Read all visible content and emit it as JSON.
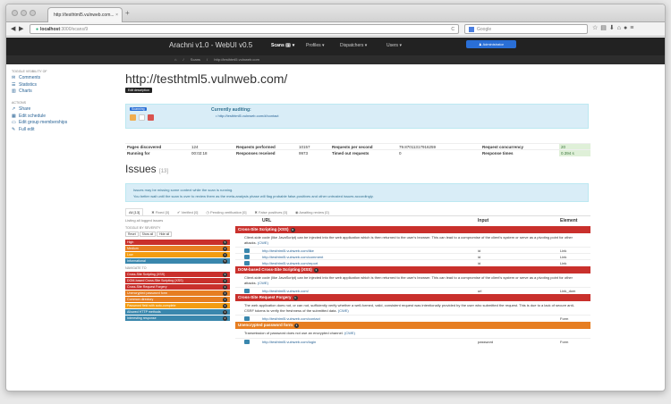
{
  "browser": {
    "tab_title": "http://testhtml5.vulnweb.com...",
    "tab_close": "×",
    "new_tab": "+",
    "url_host": "localhost",
    "url_rest": ":3000/scans/9",
    "search_placeholder": "Google",
    "reload": "C"
  },
  "nav": {
    "brand": "Arachni v1.0 - WebUI v0.5",
    "scans": "Scans",
    "scans_count": "1",
    "profiles": "Profiles ▾",
    "dispatchers": "Dispatchers ▾",
    "users": "Users ▾",
    "admin": "♟ Administrator"
  },
  "breadcrumb": {
    "home": "⌂",
    "sep1": "/",
    "scans": "Scans",
    "sep2": "/",
    "current": "http://testhtml5.vulnweb.com"
  },
  "sidebar": {
    "visibility_header": "TOGGLE VISIBILITY OF",
    "visibility_items": [
      "Comments",
      "Statistics",
      "Charts"
    ],
    "actions_header": "ACTIONS",
    "action_items": [
      "Share",
      "Edit schedule",
      "Edit group memberships",
      "Full edit"
    ]
  },
  "main": {
    "title": "http://testhtml5.vulnweb.com/",
    "edit_description": "Edit description",
    "scanning_label": "Scanning",
    "auditing_title": "Currently auditing:",
    "auditing_url": "• http://testhtml5.vulnweb.com/#/contact"
  },
  "stats": [
    [
      "Pages discovered",
      "124",
      "Requests performed",
      "10157",
      "Requests per second",
      "79.87011317916259",
      "Request concurrency",
      "20"
    ],
    [
      "Running for",
      "00:02:18",
      "Responses received",
      "9973",
      "Timed out requests",
      "0",
      "Response times",
      "0.394 s"
    ]
  ],
  "issues": {
    "title": "Issues",
    "count": "[13]",
    "warning_line1": "Issues may be missing some context while the scan is running.",
    "warning_line2": "You better wait until the scan is over to review them as the meta-analysis phase will flag probable false-positives and other untrusted issues accordingly.",
    "filters": [
      "All [13]",
      "✖ Fixed [0]",
      "✔ Verified [0]",
      "◷ Pending verification [0]",
      "✖ False positives [0]",
      "◉ Awaiting review [0]"
    ],
    "listing": "Listing all logged issues",
    "severity_header": "TOGGLE BY SEVERITY",
    "severity_buttons": [
      "Reset",
      "Show all",
      "Hide all"
    ],
    "severities": [
      {
        "label": "High",
        "count": "5",
        "color": "#c9302c"
      },
      {
        "label": "Medium",
        "count": "2",
        "color": "#e67e22"
      },
      {
        "label": "Low",
        "count": "1",
        "color": "#f39c12"
      },
      {
        "label": "Informational",
        "count": "5",
        "color": "#3a87ad"
      }
    ],
    "navigate_header": "NAVIGATE TO",
    "navigate": [
      {
        "label": "Cross-Site Scripting (XSS)",
        "count": "3",
        "color": "#c9302c"
      },
      {
        "label": "DOM-based Cross-Site Scripting (XSS)",
        "count": "1",
        "color": "#c9302c"
      },
      {
        "label": "Cross-Site Request Forgery",
        "count": "1",
        "color": "#c9302c"
      },
      {
        "label": "Unencrypted password form",
        "count": "1",
        "color": "#e67e22"
      },
      {
        "label": "Common directory",
        "count": "1",
        "color": "#e67e22"
      },
      {
        "label": "Password field with auto-complete",
        "count": "1",
        "color": "#f39c12"
      },
      {
        "label": "Allowed HTTP methods",
        "count": "1",
        "color": "#3a87ad"
      },
      {
        "label": "Interesting response",
        "count": "4",
        "color": "#3a87ad"
      }
    ],
    "columns": [
      "URL",
      "Input",
      "Element"
    ],
    "groups": [
      {
        "title": "Cross-Site Scripting (XSS)",
        "count": "3",
        "color": "#c9302c",
        "desc": "Client-side code (like JavaScript) can be injected into the web application which is then returned to the user's browser. This can lead to a compromise of the client's system or serve as a pivoting point for other attacks.",
        "cwe": "(CWE)",
        "rows": [
          [
            "http://testhtml5.vulnweb.com/like",
            "id",
            "Link"
          ],
          [
            "http://testhtml5.vulnweb.com/comment",
            "id",
            "Link"
          ],
          [
            "http://testhtml5.vulnweb.com/report",
            "id",
            "Link"
          ]
        ]
      },
      {
        "title": "DOM-based Cross-Site Scripting (XSS)",
        "count": "1",
        "color": "#c9302c",
        "desc": "Client-side code (like JavaScript) can be injected into the web application which is then returned to the user's browser. This can lead to a compromise of the client's system or serve as a pivoting point for other attacks.",
        "cwe": "(CWE)",
        "rows": [
          [
            "http://testhtml5.vulnweb.com/",
            "url",
            "Link_dom"
          ]
        ]
      },
      {
        "title": "Cross-Site Request Forgery",
        "count": "1",
        "color": "#c9302c",
        "desc": "The web application does not, or can not, sufficiently verify whether a well-formed, valid, consistent request was intentionally provided by the user who submitted the request. This is due to a lack of secure anti-CSRF tokens to verify the freshness of the submitted data.",
        "cwe": "(CWE)",
        "rows": [
          [
            "http://testhtml5.vulnweb.com/contact",
            "",
            "Form"
          ]
        ]
      },
      {
        "title": "Unencrypted password form",
        "count": "1",
        "color": "#e67e22",
        "desc": "Transmission of password does not use an encrypted channel.",
        "cwe": "(CWE)",
        "rows": [
          [
            "http://testhtml5.vulnweb.com/login",
            "password",
            "Form"
          ]
        ]
      }
    ]
  }
}
